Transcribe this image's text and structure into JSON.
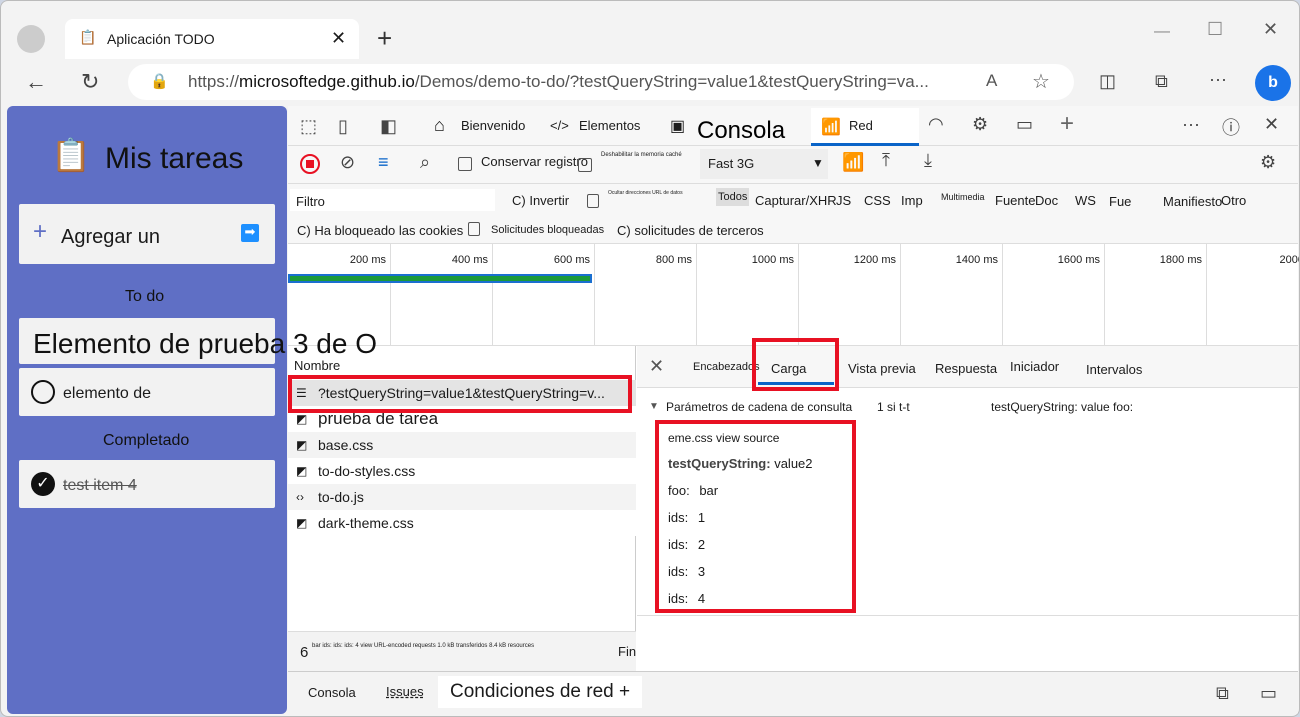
{
  "browser": {
    "tab_title": "Aplicación TODO",
    "url_prefix": "https://",
    "url_host": "microsoftedge.github.io",
    "url_path": "/Demos/demo-to-do/?testQueryString=value1&testQueryString=va..."
  },
  "app": {
    "title": "Mis tareas",
    "add_label": "Agregar un",
    "todo_heading": "To do",
    "overlay_text": "Elemento de prueba 3 de O",
    "todo_item": "elemento de",
    "completed_heading": "Completado",
    "completed_item": "test item 4"
  },
  "devtools": {
    "tabs": [
      "Bienvenido",
      "Elementos",
      "Consola",
      "Red"
    ],
    "toolbar": {
      "preserve_log": "Conservar registro",
      "disable_cache": "Deshabilitar la memoria caché",
      "throttle": "Fast 3G"
    },
    "filter": {
      "placeholder": "Filtro",
      "invert": "C) Invertir",
      "hide_data_urls": "Ocultar direcciones URL de datos",
      "types": [
        "Todos",
        "Capturar/XHR",
        "JS",
        "CSS",
        "Imp",
        "Multimedia",
        "Fuente",
        "Doc",
        "WS",
        "Fue",
        "Manifiesto",
        "Otro"
      ],
      "blocked_cookies": "C) Ha bloqueado las cookies",
      "blocked_requests": "Solicitudes bloqueadas",
      "third_party": "C) solicitudes de terceros"
    },
    "timeline_ticks": [
      "200 ms",
      "400 ms",
      "600 ms",
      "800 ms",
      "1000 ms",
      "1200 ms",
      "1400 ms",
      "1600 ms",
      "1800 ms",
      "2000"
    ],
    "requests": {
      "header": "Nombre",
      "items": [
        {
          "name": "?testQueryString=value1&testQueryString=v...",
          "icon": "document-icon"
        },
        {
          "name": "prueba de tarea",
          "icon": "stylesheet-icon"
        },
        {
          "name": "base.css",
          "icon": "stylesheet-icon"
        },
        {
          "name": "to-do-styles.css",
          "icon": "stylesheet-icon"
        },
        {
          "name": "to-do.js",
          "icon": "script-icon"
        },
        {
          "name": "dark-theme.css",
          "icon": "stylesheet-icon"
        }
      ]
    },
    "status": {
      "count": "6",
      "text": "bar ids: ids: ids: 4 view URL-encoded requests 1.0 kB transferidos 8.4 kB resources",
      "finish": "Fin"
    },
    "detail_tabs": [
      "Encabezados",
      "Carga",
      "Vista previa",
      "Respuesta",
      "Iniciador",
      "Intervalos"
    ],
    "payload": {
      "section": "Parámetros de cadena de consulta",
      "section_extra": "1 si t-t",
      "section_extra2": "testQueryString: value foo:",
      "source_line": "eme.css view source",
      "params": [
        {
          "key": "testQueryString:",
          "value": "value2"
        },
        {
          "key": "foo:",
          "value": "bar"
        },
        {
          "key": "ids:",
          "value": "1"
        },
        {
          "key": "ids:",
          "value": "2"
        },
        {
          "key": "ids:",
          "value": "3"
        },
        {
          "key": "ids:",
          "value": "4"
        }
      ]
    },
    "drawer_tabs": [
      "Consola",
      "Issues",
      "Condiciones de red +"
    ]
  }
}
